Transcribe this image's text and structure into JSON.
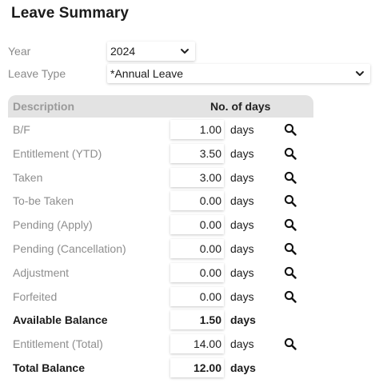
{
  "page": {
    "title": "Leave Summary"
  },
  "filters": {
    "year_label": "Year",
    "year_value": "2024",
    "leave_type_label": "Leave Type",
    "leave_type_value": "*Annual Leave"
  },
  "table": {
    "header_description": "Description",
    "header_days": "No. of days",
    "rows": [
      {
        "description": "B/F",
        "value": "1.00",
        "unit": "days",
        "has_search": true,
        "bold": false
      },
      {
        "description": "Entitlement (YTD)",
        "value": "3.50",
        "unit": "days",
        "has_search": true,
        "bold": false
      },
      {
        "description": "Taken",
        "value": "3.00",
        "unit": "days",
        "has_search": true,
        "bold": false
      },
      {
        "description": "To-be Taken",
        "value": "0.00",
        "unit": "days",
        "has_search": true,
        "bold": false
      },
      {
        "description": "Pending (Apply)",
        "value": "0.00",
        "unit": "days",
        "has_search": true,
        "bold": false
      },
      {
        "description": "Pending (Cancellation)",
        "value": "0.00",
        "unit": "days",
        "has_search": true,
        "bold": false
      },
      {
        "description": "Adjustment",
        "value": "0.00",
        "unit": "days",
        "has_search": true,
        "bold": false
      },
      {
        "description": "Forfeited",
        "value": "0.00",
        "unit": "days",
        "has_search": true,
        "bold": false
      },
      {
        "description": "Available Balance",
        "value": "1.50",
        "unit": "days",
        "has_search": false,
        "bold": true
      },
      {
        "description": "Entitlement (Total)",
        "value": "14.00",
        "unit": "days",
        "has_search": true,
        "bold": false
      },
      {
        "description": "Total Balance",
        "value": "12.00",
        "unit": "days",
        "has_search": false,
        "bold": true
      }
    ]
  },
  "icons": {
    "search": "search-icon",
    "dropdown": "chevron-down-icon"
  }
}
